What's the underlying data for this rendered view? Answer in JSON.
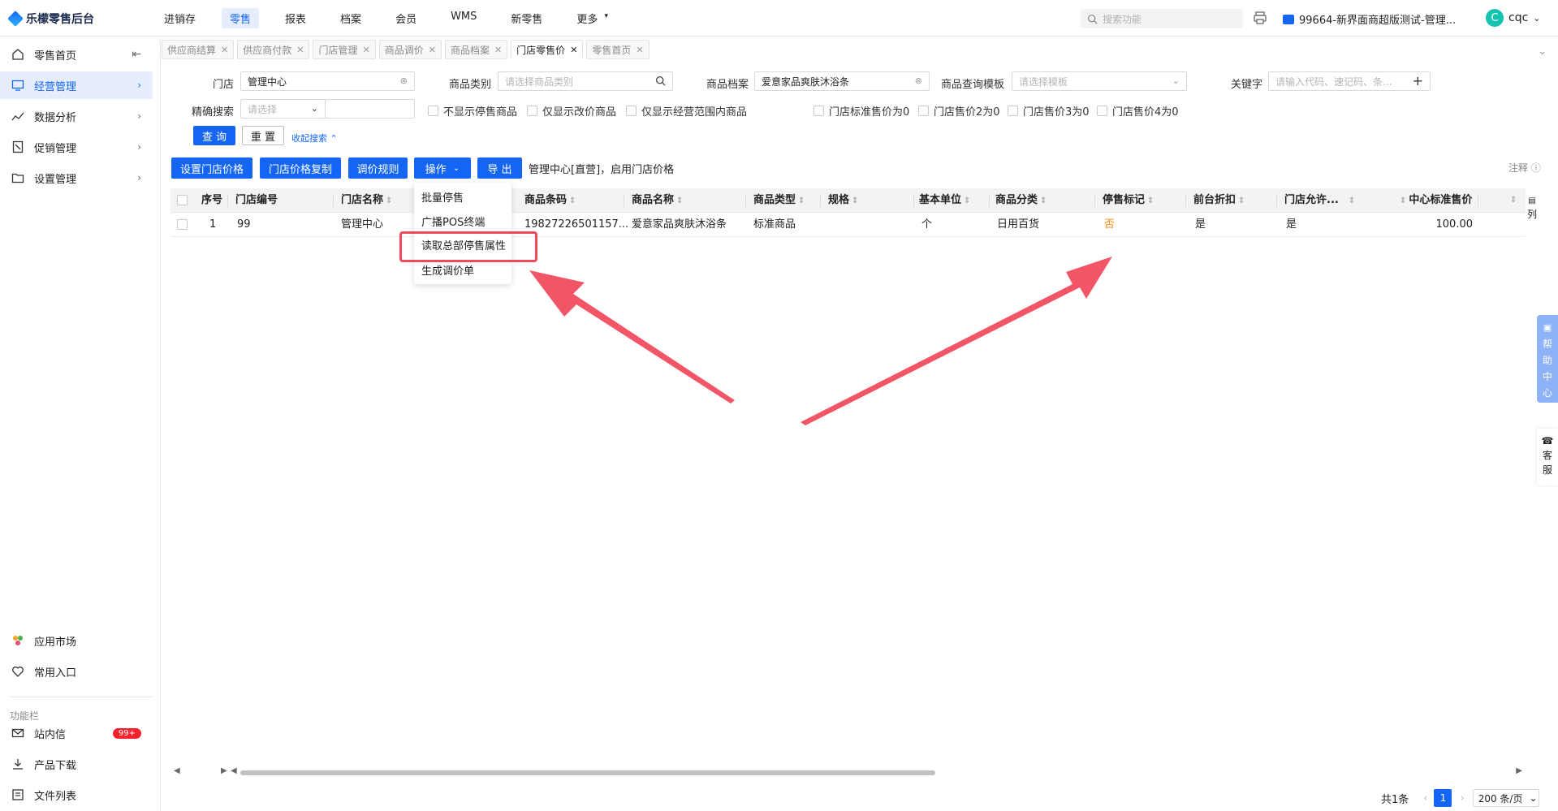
{
  "app": {
    "title": "乐檬零售后台"
  },
  "topnav": [
    "进销存",
    "零售",
    "报表",
    "档案",
    "会员",
    "WMS",
    "新零售",
    "更多"
  ],
  "topnav_active": 1,
  "search": {
    "placeholder": "搜索功能"
  },
  "org_label": "99664-新界面商超版测试-管理...",
  "user": {
    "initial": "C",
    "name": "cqc"
  },
  "sidebar": {
    "items": [
      {
        "label": "零售首页",
        "icon": "home-icon"
      },
      {
        "label": "经营管理",
        "icon": "monitor-icon"
      },
      {
        "label": "数据分析",
        "icon": "chart-line-icon"
      },
      {
        "label": "促销管理",
        "icon": "promotion-icon"
      },
      {
        "label": "设置管理",
        "icon": "folder-icon"
      }
    ],
    "bottom_items": [
      {
        "label": "应用市场",
        "icon": "app-market-icon"
      },
      {
        "label": "常用入口",
        "icon": "heart-icon"
      }
    ],
    "section_title": "功能栏",
    "func_items": [
      {
        "label": "站内信",
        "icon": "mail-icon",
        "badge": "99+"
      },
      {
        "label": "产品下载",
        "icon": "download-icon"
      },
      {
        "label": "文件列表",
        "icon": "file-list-icon"
      }
    ]
  },
  "tabs": [
    "供应商结算",
    "供应商付款",
    "门店管理",
    "商品调价",
    "商品档案",
    "门店零售价",
    "零售首页"
  ],
  "tabs_active": 5,
  "filters": {
    "store_label": "门店",
    "store_value": "管理中心",
    "category_label": "商品类别",
    "category_placeholder": "请选择商品类别",
    "product_label": "商品档案",
    "product_value": "爱意家品爽肤沐浴条",
    "template_label": "商品查询模板",
    "template_placeholder": "请选择模板",
    "keyword_label": "关键字",
    "keyword_placeholder": "请输入代码、速记码、条...",
    "exact_label": "精确搜索",
    "exact_placeholder": "请选择",
    "checkboxes": [
      "不显示停售商品",
      "仅显示改价商品",
      "仅显示经营范围内商品",
      "门店标准售价为0",
      "门店售价2为0",
      "门店售价3为0",
      "门店售价4为0"
    ],
    "query_btn": "查 询",
    "reset_btn": "重 置",
    "collapse_link": "收起搜索"
  },
  "toolbar": {
    "set_price": "设置门店价格",
    "copy_price": "门店价格复制",
    "rule": "调价规则",
    "operate": "操作",
    "export": "导 出",
    "info": "管理中心[直营]，启用门店价格",
    "note": "注释"
  },
  "dropdown": [
    "批量停售",
    "广播POS终端",
    "读取总部停售属性",
    "生成调价单"
  ],
  "table": {
    "headers": [
      "序号",
      "门店编号",
      "门店名称",
      "商品条码",
      "商品名称",
      "商品类型",
      "规格",
      "基本单位",
      "商品分类",
      "停售标记",
      "前台折扣",
      "门店允许...",
      "中心标准售价"
    ],
    "rows": [
      [
        "1",
        "99",
        "管理中心",
        "19827226501157...",
        "爱意家品爽肤沐浴条",
        "标准商品",
        "",
        "个",
        "日用百货",
        "否",
        "是",
        "是",
        "100.00"
      ]
    ],
    "col_toggle": "列"
  },
  "pagination": {
    "total": "共1条",
    "current": "1",
    "page_size": "200 条/页"
  },
  "help": {
    "label": "帮助中心",
    "service": "客服"
  },
  "colors": {
    "accent": "#1565f5",
    "arrow": "#f04a5a",
    "orange": "#fa8c16"
  }
}
